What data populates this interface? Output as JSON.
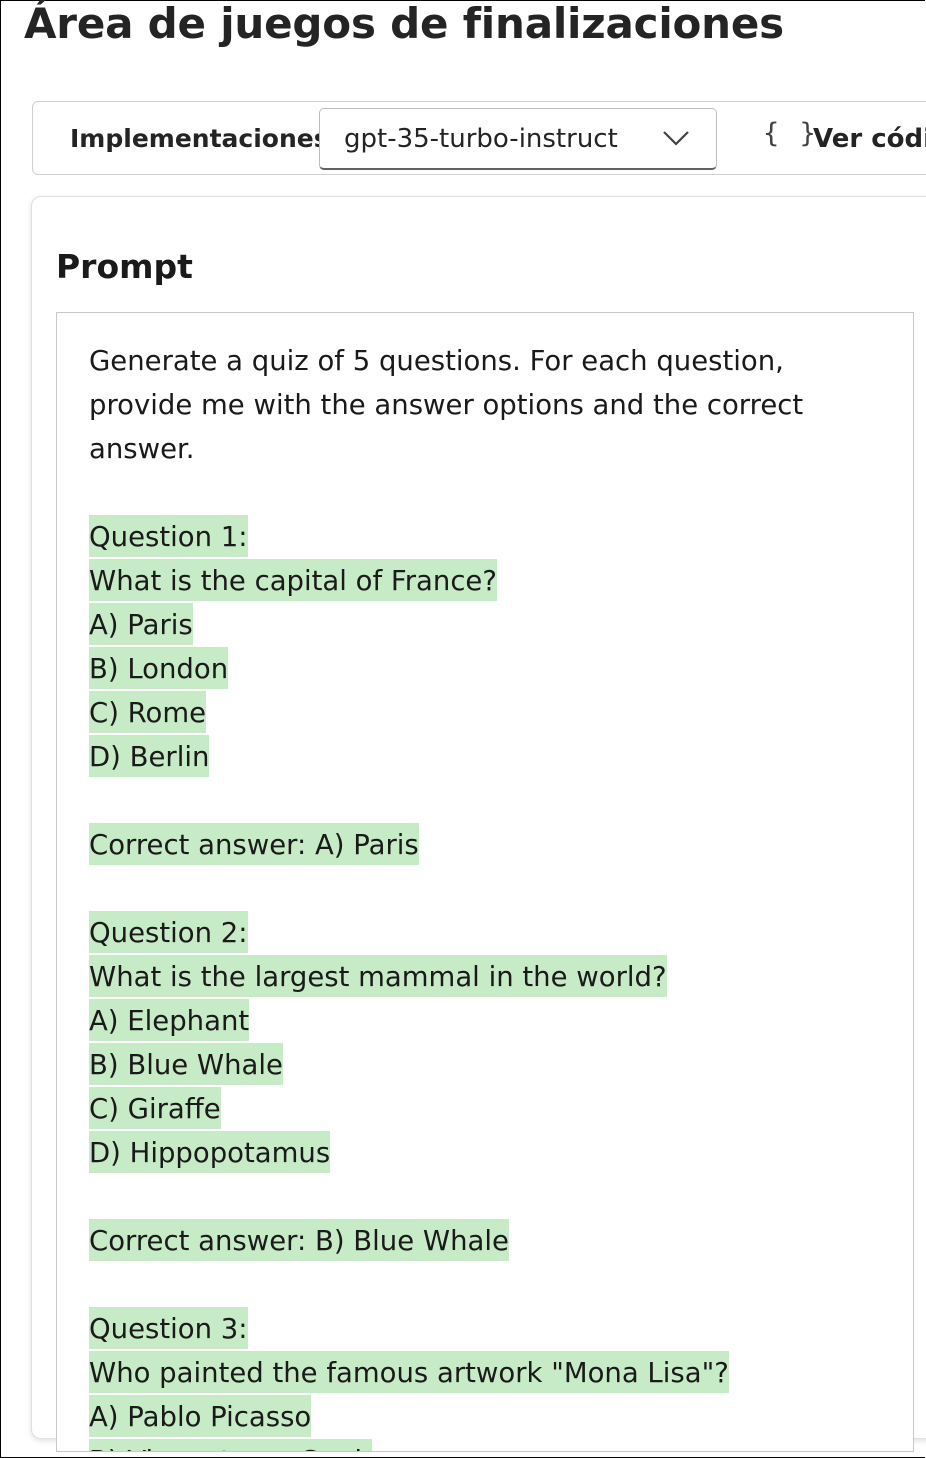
{
  "page": {
    "title": "Área de juegos de finalizaciones"
  },
  "toolbar": {
    "deployments_label": "Implementaciones",
    "deployment_selected": "gpt-35-turbo-instruct",
    "view_code_icon": "{ }",
    "view_code_label": "Ver código"
  },
  "prompt_panel": {
    "title": "Prompt",
    "prompt_lines": [
      "Generate a quiz of 5 questions. For each question,",
      "provide me with the answer options and the correct",
      "answer."
    ],
    "completion_lines": [
      "",
      "Question 1:",
      "What is the capital of France?",
      "A) Paris",
      "B) London",
      "C) Rome",
      "D) Berlin",
      "",
      "Correct answer: A) Paris",
      "",
      "Question 2:",
      "What is the largest mammal in the world?",
      "A) Elephant",
      "B) Blue Whale",
      "C) Giraffe",
      "D) Hippopotamus",
      "",
      "Correct answer: B) Blue Whale",
      "",
      "Question 3:",
      "Who painted the famous artwork \"Mona Lisa\"?",
      "A) Pablo Picasso",
      "B) Vincent van Gogh"
    ],
    "highlight_color": "#c7ebc6"
  }
}
